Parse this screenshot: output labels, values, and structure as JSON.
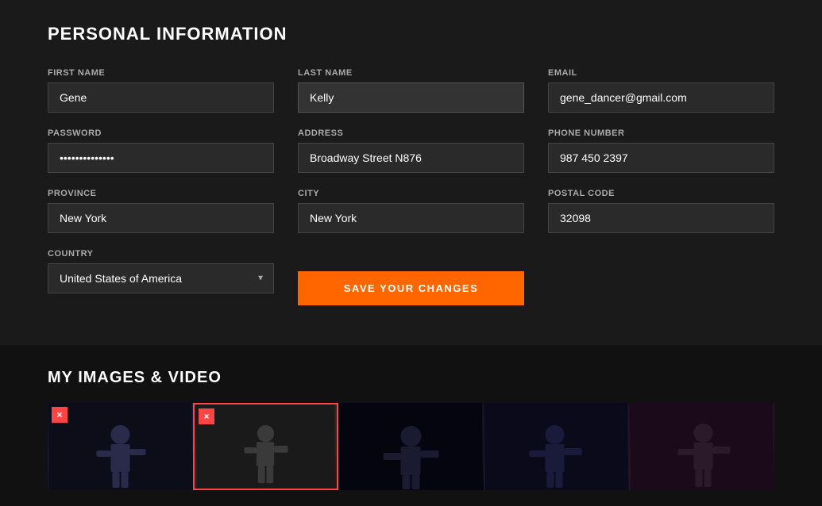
{
  "personal_info": {
    "section_title": "PERSONAL INFORMATION",
    "fields": {
      "first_name_label": "FIRST NAME",
      "first_name_value": "Gene",
      "last_name_label": "LAST NAME",
      "last_name_value": "Kelly",
      "email_label": "EMAIL",
      "email_value": "gene_dancer@gmail.com",
      "password_label": "PASSWORD",
      "password_value": "••••••••••••••",
      "address_label": "ADDRESS",
      "address_value": "Broadway Street N876",
      "phone_label": "PHONE NUMBER",
      "phone_value": "987 450 2397",
      "province_label": "PROVINCE",
      "province_value": "New York",
      "city_label": "CITY",
      "city_value": "New York",
      "postal_label": "POSTAL CODE",
      "postal_value": "32098",
      "country_label": "COUNTRY",
      "country_value": "United States of America"
    },
    "save_button_label": "SAVE YOUR CHANGES"
  },
  "media_section": {
    "section_title": "MY IMAGES & VIDEO",
    "delete_button_label": "×",
    "items": [
      {
        "id": 1,
        "has_delete": true,
        "thumb_class": "thumb-1"
      },
      {
        "id": 2,
        "has_delete": true,
        "thumb_class": "thumb-2"
      },
      {
        "id": 3,
        "has_delete": false,
        "thumb_class": "thumb-3"
      },
      {
        "id": 4,
        "has_delete": false,
        "thumb_class": "thumb-4"
      },
      {
        "id": 5,
        "has_delete": false,
        "thumb_class": "thumb-5"
      }
    ]
  }
}
